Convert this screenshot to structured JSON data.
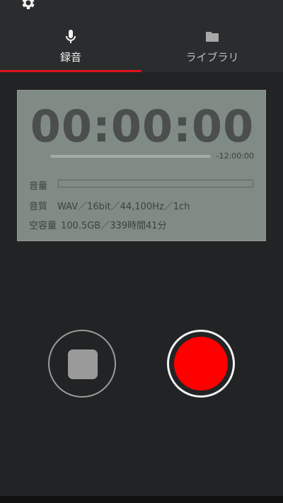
{
  "header": {
    "settings_icon": "gear-icon",
    "tabs": [
      {
        "label": "録音",
        "icon": "microphone-icon",
        "active": true
      },
      {
        "label": "ライブラリ",
        "icon": "folder-icon",
        "active": false
      }
    ]
  },
  "display": {
    "timer": "00:00:00",
    "remaining": "-12:00:00",
    "progress_fraction": 0,
    "volume_label": "音量",
    "volume_level_fraction": 0,
    "quality_label": "音質",
    "quality_value": "WAV／16bit／44,100Hz／1ch",
    "space_label": "空容量",
    "space_value": "100.5GB／339時間41分"
  },
  "controls": {
    "stop_icon": "stop-icon",
    "record_icon": "record-icon"
  },
  "colors": {
    "accent": "#e0141c",
    "record": "#ff0000",
    "lcd_background": "#7f8b84",
    "lcd_text": "#4a4e4c"
  }
}
